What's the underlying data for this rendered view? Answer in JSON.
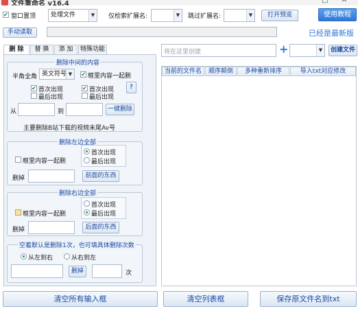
{
  "window": {
    "title": "文件重命名 v16.4",
    "controls": "─ □ ✕"
  },
  "toolbar": {
    "pin_label": "窗口置顶",
    "pin_checked": true,
    "mode_select": "处理文件",
    "only_ext_label": "仅检索扩展名:",
    "skip_ext_label": "跳过扩展名:",
    "open_preview": "打开预览",
    "tutorial": "使用教程",
    "manual_read": "手动读取",
    "version_status": "已经是最新版"
  },
  "tabs": [
    "删 除",
    "替 换",
    "添 加",
    "特殊功能"
  ],
  "delete_middle": {
    "title": "删除中间的内容",
    "width_label": "半角全角",
    "char_select": "英文符号",
    "frame_content_label": "框里内容一起删",
    "frame_content_checked": true,
    "left": {
      "first_label": "首次出现",
      "first_checked": true,
      "last_label": "最后出现",
      "last_checked": false
    },
    "right": {
      "first_label": "首次出现",
      "first_checked": true,
      "last_label": "最后出现",
      "last_checked": false
    },
    "help": "?",
    "from_label": "从",
    "to_label": "到",
    "one_click": "一键删除",
    "note": "主要删除B站下载的视频末尾Av号"
  },
  "delete_left": {
    "title": "删除左边全部",
    "frame_label": "框里内容一起删",
    "first_label": "首次出现",
    "last_label": "最后出现",
    "selected": "first",
    "delete_label": "删掉",
    "button": "前面的东西"
  },
  "delete_right": {
    "title": "删除右边全部",
    "frame_label": "框里内容一起删",
    "first_label": "首次出现",
    "last_label": "最后出现",
    "selected": "last",
    "delete_label": "删掉",
    "button": "后面的东西"
  },
  "delete_count": {
    "title": "空着默认是删除1次，也可填具体删除次数",
    "left_to_right": "从左到右",
    "right_to_left": "从右到左",
    "selected": "left",
    "delete_button": "删掉",
    "times_label": "次"
  },
  "right_panel": {
    "create_placeholder": "将在这里创建",
    "plus": "+",
    "create_file": "创建文件",
    "columns": [
      "当前的文件名",
      "顺序颠倒",
      "多种重新排序",
      "导入txt对应修改"
    ]
  },
  "bottom": {
    "clear_inputs": "清空所有输入框",
    "clear_list": "清空列表框",
    "save_names": "保存原文件名到txt"
  },
  "colors": {
    "accent": "#2f78d8",
    "title_blue": "#1a4aa0",
    "panel_bg": "#eef3f9"
  }
}
